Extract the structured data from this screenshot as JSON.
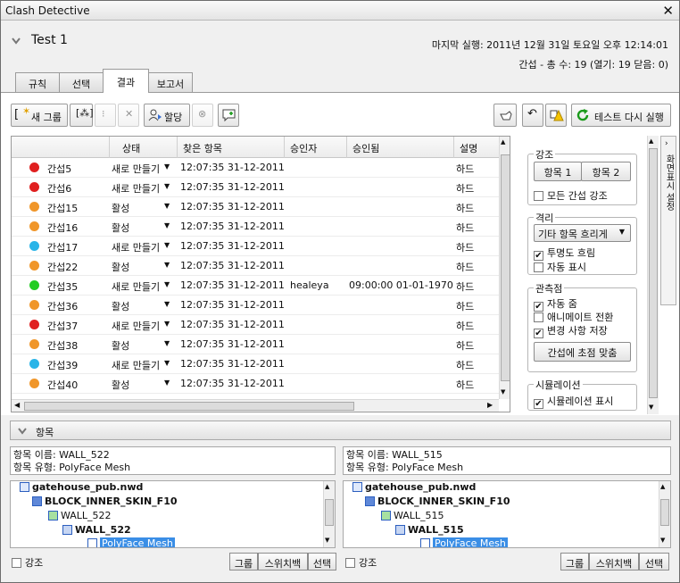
{
  "window": {
    "title": "Clash Detective"
  },
  "test": {
    "name": "Test 1",
    "last_run_label": "마지막 실행:",
    "last_run_value": "2011년 12월 31일 토요일 오후 12:14:01",
    "clash_summary": "간섭 - 총 수: 19 (열기: 19 닫음: 0)"
  },
  "tabs": [
    {
      "label": "규칙"
    },
    {
      "label": "선택"
    },
    {
      "label": "결과"
    },
    {
      "label": "보고서"
    }
  ],
  "toolbar": {
    "new_group": "새 그룹",
    "assign": "할당",
    "rerun": "테스트 다시 실행"
  },
  "grid": {
    "columns": [
      "상태",
      "찾은 항목",
      "승인자",
      "승인됨",
      "설명"
    ],
    "rows": [
      {
        "name": "간섭5",
        "color": "#e02020",
        "status": "새로 만들기",
        "found": "12:07:35 31-12-2011",
        "approver": "",
        "approved": "",
        "desc": "하드"
      },
      {
        "name": "간섭6",
        "color": "#e02020",
        "status": "새로 만들기",
        "found": "12:07:35 31-12-2011",
        "approver": "",
        "approved": "",
        "desc": "하드"
      },
      {
        "name": "간섭15",
        "color": "#f0962a",
        "status": "활성",
        "found": "12:07:35 31-12-2011",
        "approver": "",
        "approved": "",
        "desc": "하드"
      },
      {
        "name": "간섭16",
        "color": "#f0962a",
        "status": "활성",
        "found": "12:07:35 31-12-2011",
        "approver": "",
        "approved": "",
        "desc": "하드"
      },
      {
        "name": "간섭17",
        "color": "#2ab4e8",
        "status": "새로 만들기",
        "found": "12:07:35 31-12-2011",
        "approver": "",
        "approved": "",
        "desc": "하드"
      },
      {
        "name": "간섭22",
        "color": "#f0962a",
        "status": "활성",
        "found": "12:07:35 31-12-2011",
        "approver": "",
        "approved": "",
        "desc": "하드"
      },
      {
        "name": "간섭35",
        "color": "#22cc22",
        "status": "새로 만들기",
        "found": "12:07:35 31-12-2011",
        "approver": "healeya",
        "approved": "09:00:00 01-01-1970",
        "desc": "하드"
      },
      {
        "name": "간섭36",
        "color": "#f0962a",
        "status": "활성",
        "found": "12:07:35 31-12-2011",
        "approver": "",
        "approved": "",
        "desc": "하드"
      },
      {
        "name": "간섭37",
        "color": "#e02020",
        "status": "새로 만들기",
        "found": "12:07:35 31-12-2011",
        "approver": "",
        "approved": "",
        "desc": "하드"
      },
      {
        "name": "간섭38",
        "color": "#f0962a",
        "status": "활성",
        "found": "12:07:35 31-12-2011",
        "approver": "",
        "approved": "",
        "desc": "하드"
      },
      {
        "name": "간섭39",
        "color": "#2ab4e8",
        "status": "새로 만들기",
        "found": "12:07:35 31-12-2011",
        "approver": "",
        "approved": "",
        "desc": "하드"
      },
      {
        "name": "간섭40",
        "color": "#f0962a",
        "status": "활성",
        "found": "12:07:35 31-12-2011",
        "approver": "",
        "approved": "",
        "desc": "하드"
      }
    ]
  },
  "side": {
    "highlight": {
      "legend": "강조",
      "item1": "항목 1",
      "item2": "항목 2",
      "all": "모든 간섭 강조"
    },
    "isolate": {
      "legend": "격리",
      "dropdown": "기타 항목 흐리게",
      "transparent": "투명도 흐림",
      "autoshow": "자동 표시"
    },
    "viewpoint": {
      "legend": "관측점",
      "autozoom": "자동 줌",
      "animate": "애니메이트 전환",
      "savechanges": "변경 사항 저장",
      "focus": "간섭에 초점 맞춤"
    },
    "simulation": {
      "legend": "시뮬레이션",
      "show": "시뮬레이션 표시"
    },
    "tab_label": "화면표시 설정"
  },
  "items": {
    "header": "항목",
    "left": {
      "name_line": "항목 이름: WALL_522",
      "type_line": "항목 유형: PolyFace Mesh",
      "tree": [
        "gatehouse_pub.nwd",
        "BLOCK_INNER_SKIN_F10",
        "WALL_522",
        "WALL_522",
        "PolyFace Mesh"
      ]
    },
    "right": {
      "name_line": "항목 이름: WALL_515",
      "type_line": "항목 유형: PolyFace Mesh",
      "tree": [
        "gatehouse_pub.nwd",
        "BLOCK_INNER_SKIN_F10",
        "WALL_515",
        "WALL_515",
        "PolyFace Mesh"
      ]
    },
    "highlight": "강조",
    "group": "그룹",
    "switchback": "스위치백",
    "select": "선택"
  },
  "colors": {
    "accent": "#3a8ee6",
    "selection": "#3a8ee6"
  }
}
